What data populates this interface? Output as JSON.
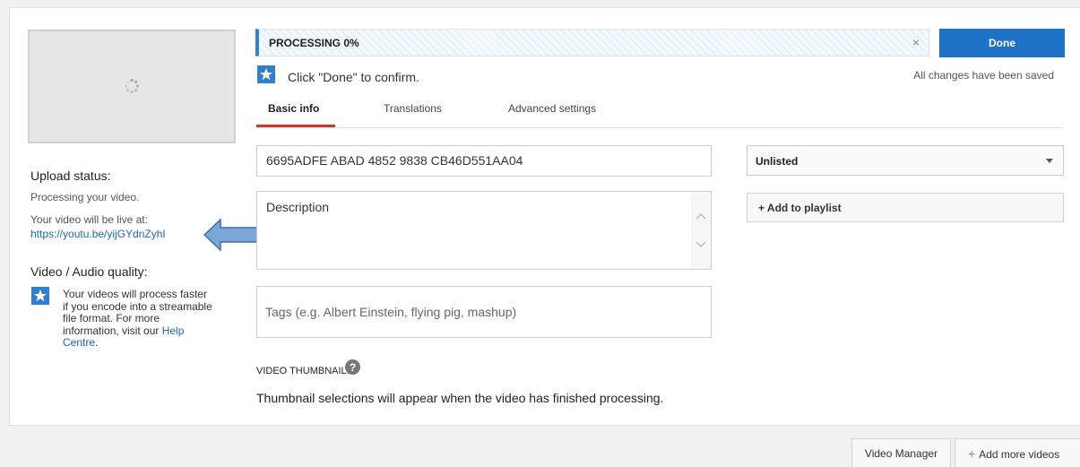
{
  "processing": {
    "status_text": "PROCESSING 0%",
    "progress_percent": 0,
    "close_glyph": "×",
    "done_label": "Done",
    "saved_text": "All changes have been saved",
    "confirm_text": "Click \"Done\" to confirm."
  },
  "tabs": [
    {
      "label": "Basic info",
      "active": true
    },
    {
      "label": "Translations",
      "active": false
    },
    {
      "label": "Advanced settings",
      "active": false
    }
  ],
  "form": {
    "title_value": "6695ADFE ABAD 4852 9838 CB46D551AA04",
    "description_placeholder": "Description",
    "tags_placeholder": "Tags (e.g. Albert Einstein, flying pig, mashup)",
    "privacy_value": "Unlisted",
    "add_playlist_label": "+ Add to playlist"
  },
  "sidebar": {
    "upload_status_title": "Upload status:",
    "processing_text": "Processing your video.",
    "live_label": "Your video will be live at:",
    "live_url": "https://youtu.be/yijGYdnZyhI",
    "quality_title": "Video / Audio quality:",
    "tip_text": "Your videos will process faster if you encode into a streamable file format. For more information, visit our",
    "help_link": "Help Centre",
    "tip_end": "."
  },
  "thumbnails": {
    "title": "VIDEO THUMBNAILS",
    "message": "Thumbnail selections will appear when the video has finished processing."
  },
  "bottom": {
    "video_manager_label": "Video Manager",
    "add_more_label": "Add more videos",
    "add_more_glyph": "+"
  },
  "colors": {
    "accent_blue": "#1f73c6",
    "tab_underline": "#e52d27",
    "link": "#1a66b8",
    "arrow_fill": "#7aa7d8"
  },
  "icons": {
    "spinner": "loading-spinner-icon",
    "star": "star-icon",
    "help": "question-mark-icon",
    "close": "close-icon",
    "caret": "caret-down-icon",
    "arrow": "left-arrow-icon"
  }
}
